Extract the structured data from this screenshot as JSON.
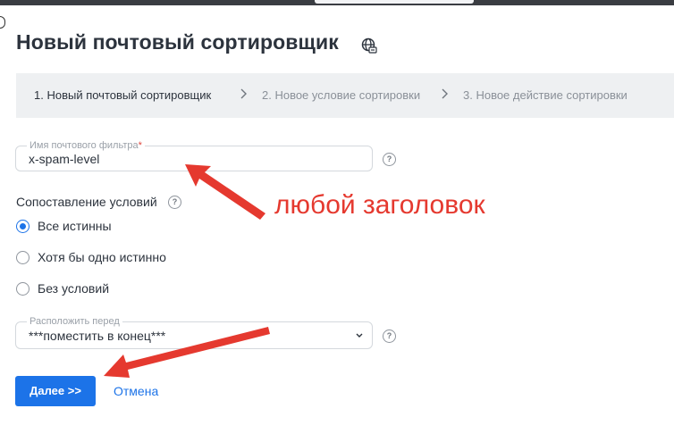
{
  "header": {
    "title": "Новый почтовый сортировщик",
    "title_icon": "globe-icon"
  },
  "steps": [
    {
      "label": "1. Новый почтовый сортировщик",
      "active": true
    },
    {
      "label": "2. Новое условие сортировки",
      "active": false
    },
    {
      "label": "3. Новое действие сортировки",
      "active": false
    }
  ],
  "filter_name": {
    "label": "Имя почтового фильтра",
    "required_mark": "*",
    "value": "x-spam-level",
    "help_icon": "help-icon"
  },
  "conditions": {
    "label": "Сопоставление условий",
    "options": [
      {
        "label": "Все истинны",
        "selected": true
      },
      {
        "label": "Хотя бы одно истинно",
        "selected": false
      },
      {
        "label": "Без условий",
        "selected": false
      }
    ]
  },
  "position": {
    "label": "Расположить перед",
    "value": "***поместить в конец***"
  },
  "actions": {
    "next_label": "Далее >>",
    "cancel_label": "Отмена"
  },
  "annotation": {
    "text": "любой заголовок",
    "color": "#e5392f"
  },
  "colors": {
    "accent": "#1c73e8",
    "title": "#2c333d",
    "stepper_bg": "#eef0f2"
  }
}
